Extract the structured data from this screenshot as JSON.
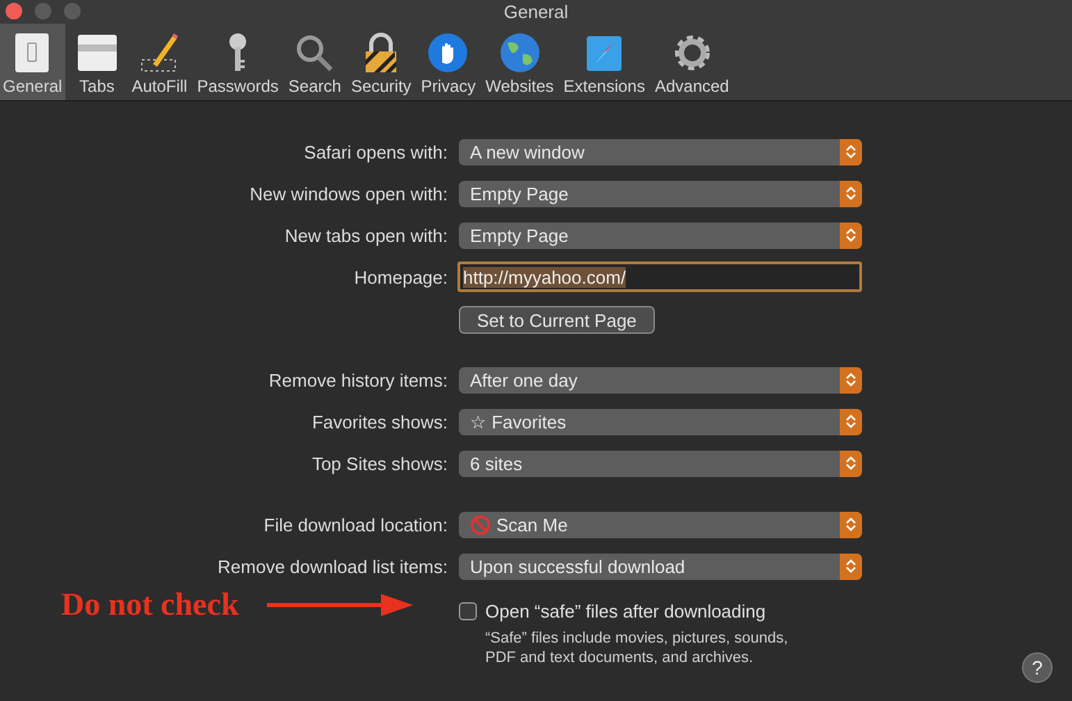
{
  "window": {
    "title": "General"
  },
  "toolbar": [
    {
      "label": "General",
      "kind": "switch",
      "selected": true
    },
    {
      "label": "Tabs",
      "kind": "tabs",
      "selected": false
    },
    {
      "label": "AutoFill",
      "kind": "pencil",
      "selected": false
    },
    {
      "label": "Passwords",
      "kind": "key",
      "selected": false
    },
    {
      "label": "Search",
      "kind": "magnifier",
      "selected": false
    },
    {
      "label": "Security",
      "kind": "lock",
      "selected": false
    },
    {
      "label": "Privacy",
      "kind": "hand",
      "selected": false
    },
    {
      "label": "Websites",
      "kind": "globe",
      "selected": false
    },
    {
      "label": "Extensions",
      "kind": "compass",
      "selected": false
    },
    {
      "label": "Advanced",
      "kind": "gear",
      "selected": false
    }
  ],
  "sections": [
    {
      "rows": [
        {
          "kind": "popup",
          "label": "Safari opens with:",
          "value": "A new window"
        },
        {
          "kind": "popup",
          "label": "New windows open with:",
          "value": "Empty Page"
        },
        {
          "kind": "popup",
          "label": "New tabs open with:",
          "value": "Empty Page"
        },
        {
          "kind": "field",
          "label": "Homepage:",
          "value": "http://myyahoo.com/"
        },
        {
          "kind": "button",
          "value": "Set to Current Page"
        }
      ]
    },
    {
      "rows": [
        {
          "kind": "popup",
          "label": "Remove history items:",
          "value": "After one day"
        },
        {
          "kind": "popup",
          "label": "Favorites shows:",
          "value": "☆ Favorites"
        },
        {
          "kind": "popup",
          "label": "Top Sites shows:",
          "value": "6 sites"
        }
      ]
    },
    {
      "rows": [
        {
          "kind": "folder-popup",
          "label": "File download location:",
          "value": "Scan Me"
        },
        {
          "kind": "popup",
          "label": "Remove download list items:",
          "value": "Upon successful download"
        },
        {
          "kind": "checkbox",
          "value": "Open “safe” files after downloading",
          "checked": false,
          "note": "“Safe” files include movies, pictures, sounds, PDF and text documents, and archives."
        }
      ]
    }
  ],
  "annotation": {
    "text": "Do not check"
  },
  "help_button": "?"
}
